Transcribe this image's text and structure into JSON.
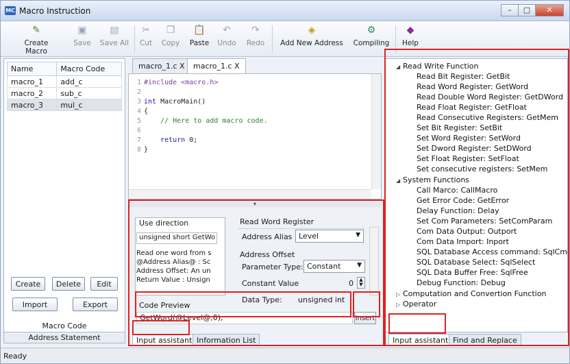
{
  "window": {
    "title": "Macro Instruction",
    "icon_label": "MC"
  },
  "toolbar": {
    "create_macro": "Create Macro",
    "save": "Save",
    "save_all": "Save All",
    "cut": "Cut",
    "copy": "Copy",
    "paste": "Paste",
    "undo": "Undo",
    "redo": "Redo",
    "add_new_address": "Add New Address",
    "compiling": "Compiling",
    "help": "Help"
  },
  "macro_list": {
    "headers": [
      "Name",
      "Macro Code"
    ],
    "rows": [
      {
        "name": "macro_1",
        "code": "add_c"
      },
      {
        "name": "macro_2",
        "code": "sub_c"
      },
      {
        "name": "macro_3",
        "code": "mul_c"
      }
    ],
    "buttons": {
      "create": "Create",
      "delete": "Delete",
      "edit": "Edit",
      "import": "Import",
      "export": "Export"
    },
    "footer_label": "Macro Code",
    "address_tab": "Address Statement"
  },
  "editor": {
    "tabs": [
      "macro_1.c X",
      "macro_1.c X"
    ],
    "lines": [
      {
        "n": "1",
        "pre": "#include <macro.h>"
      },
      {
        "n": "2",
        "text": ""
      },
      {
        "n": "3",
        "kw": "int",
        "text": " MacroMain()"
      },
      {
        "n": "4",
        "text": "{"
      },
      {
        "n": "5",
        "comment": "    // Here to add macro code."
      },
      {
        "n": "6",
        "text": ""
      },
      {
        "n": "7",
        "kw": "    return",
        "text": " 0;"
      },
      {
        "n": "8",
        "text": "}"
      }
    ]
  },
  "assistant": {
    "use_direction_title": "Use direction",
    "signature": "unsigned short GetWo",
    "description": [
      "Read one word from s",
      "@Address Alias@ : Sc",
      "Address Offset: An un",
      "Return Value : Unsign"
    ],
    "function_title": "Read Word Register",
    "address_alias_label": "Address Alias",
    "address_alias_value": "Level",
    "address_offset_label": "Address Offset",
    "parameter_type_label": "Parameter Type:",
    "parameter_type_value": "Constant",
    "constant_value_label": "Constant Value",
    "constant_value": "0",
    "data_type_label": "Data Type:",
    "data_type_value": "unsigned int",
    "code_preview_label": "Code Preview",
    "code_preview": "GetWord(@Level@,0);",
    "insert_button": "Insert",
    "tabs": [
      "Input assistant",
      "Information List"
    ]
  },
  "function_tree": {
    "groups": [
      {
        "label": "Read Write Function",
        "expanded": true,
        "items": [
          "Read Bit Register: GetBit",
          "Read Word Register: GetWord",
          "Read Double Word Register: GetDWord",
          "Read Float Register: GetFloat",
          "Read Consecutive Registers: GetMem",
          "Set Bit Register: SetBit",
          "Set Word Register: SetWord",
          "Set Dword Register: SetDWord",
          "Set Float Register: SetFloat",
          "Set consecutive registers: SetMem"
        ]
      },
      {
        "label": "System Functions",
        "expanded": true,
        "items": [
          "Call Marco: CallMacro",
          "Get Error Code: GetError",
          "Delay Function: Delay",
          "Set Com Parameters: SetComParam",
          "Com Data Output: Outport",
          "Com Data Import: Inport",
          "SQL Database Access command: SqlCmd",
          "SQL Database Select: SqlSelect",
          "SQL Data Buffer Free: SqlFree",
          "Debug Function: Debug"
        ]
      },
      {
        "label": "Computation and Convertion Function",
        "expanded": false,
        "items": []
      },
      {
        "label": "Operator",
        "expanded": false,
        "items": []
      }
    ],
    "tabs": [
      "Input assistant",
      "Find and Replace"
    ]
  },
  "status": {
    "text": "Ready"
  }
}
